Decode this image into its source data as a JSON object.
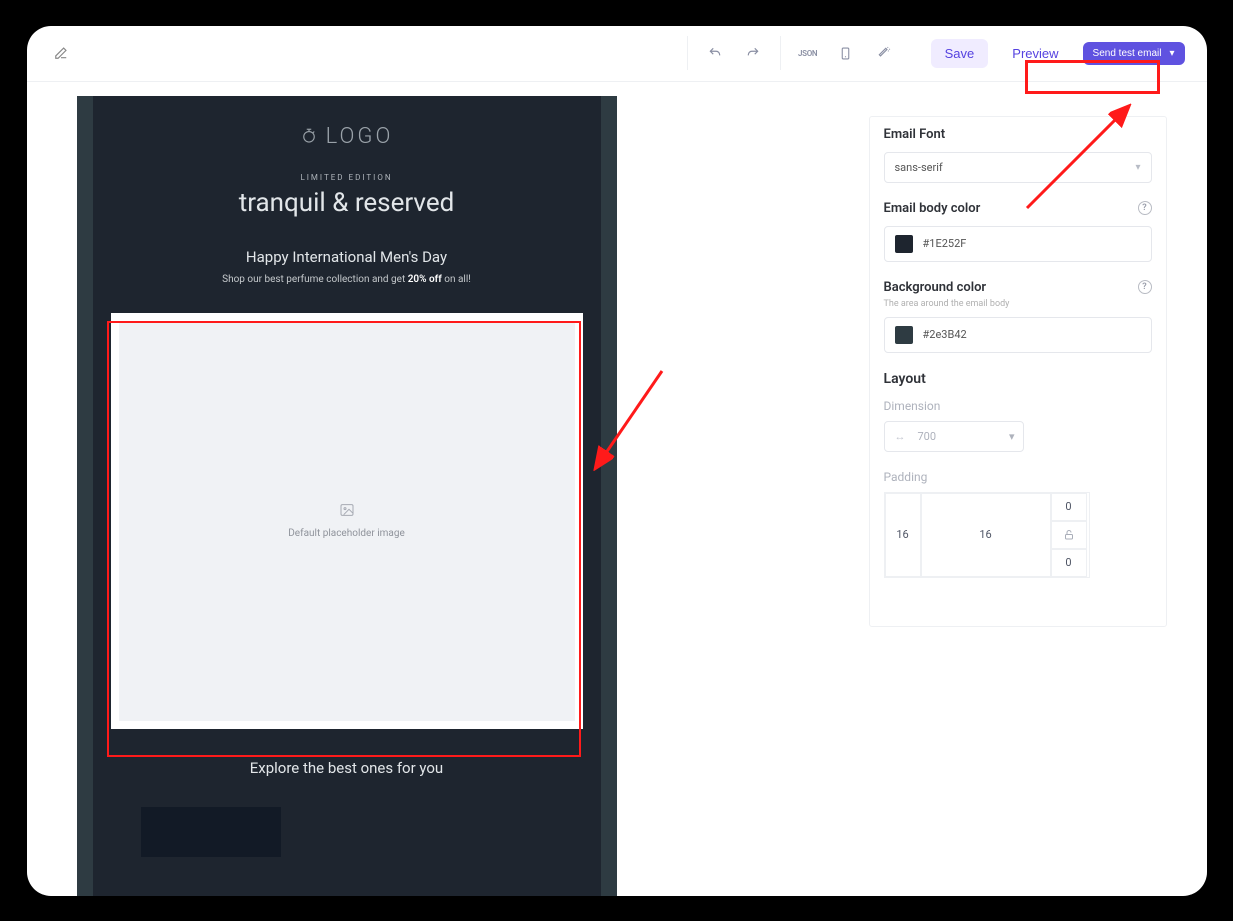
{
  "toolbar": {
    "json_label": "JSON",
    "save_label": "Save",
    "preview_label": "Preview",
    "send_test_label": "Send test email"
  },
  "email": {
    "logo_text": "LOGO",
    "limited": "LIMITED EDITION",
    "headline": "tranquil & reserved",
    "subhead": "Happy International Men's Day",
    "tagline_pre": "Shop our best perfume collection and get",
    "tagline_bold": "20% off",
    "tagline_post": "on all!",
    "placeholder_label": "Default placeholder image",
    "explore": "Explore the best ones for you"
  },
  "panel": {
    "font_label": "Email Font",
    "font_value": "sans-serif",
    "body_color_label": "Email body color",
    "body_color_value": "#1E252F",
    "bg_color_label": "Background color",
    "bg_color_helper": "The area around the email body",
    "bg_color_value": "#2e3B42",
    "layout_label": "Layout",
    "dimension_label": "Dimension",
    "dimension_value": "700",
    "padding_label": "Padding",
    "padding": {
      "top": "0",
      "right": "16",
      "bottom": "0",
      "left": "16"
    }
  }
}
